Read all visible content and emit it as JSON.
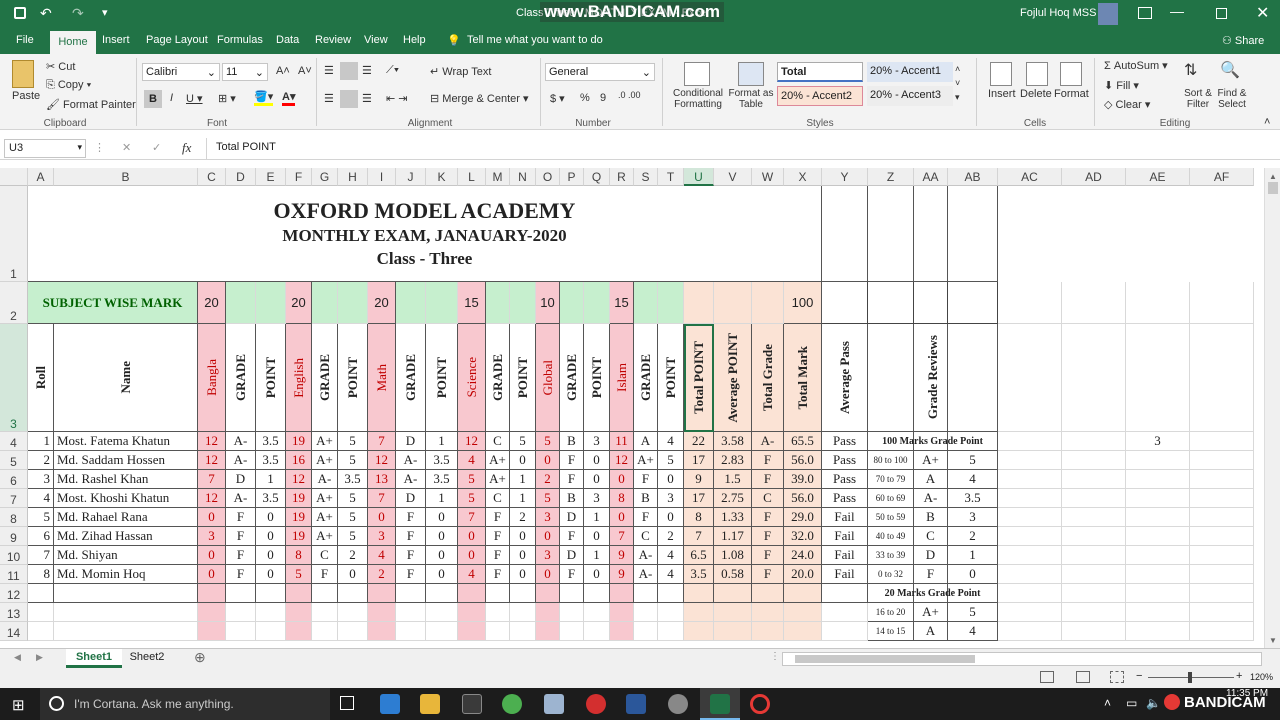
{
  "app": {
    "title": "Class Three - MONTHLY EXAM - Excel",
    "watermark": "www.BANDICAM.com",
    "user": "Fojlul Hoq MSS"
  },
  "menu": [
    "File",
    "Home",
    "Insert",
    "Page Layout",
    "Formulas",
    "Data",
    "Review",
    "View",
    "Help"
  ],
  "tell_me": "Tell me what you want to do",
  "share": "Share",
  "ribbon": {
    "paste": "Paste",
    "cut": "Cut",
    "copy": "Copy",
    "format_painter": "Format Painter",
    "clipboard": "Clipboard",
    "font_name": "Calibri",
    "font_size": "11",
    "font": "Font",
    "wrap_text": "Wrap Text",
    "merge_center": "Merge & Center",
    "alignment": "Alignment",
    "number_format": "General",
    "number": "Number",
    "conditional": "Conditional Formatting",
    "format_as_table": "Format as Table",
    "style_total": "Total",
    "style_a1": "20% - Accent1",
    "style_a2": "20% - Accent2",
    "style_a3": "20% - Accent3",
    "styles": "Styles",
    "insert": "Insert",
    "delete": "Delete",
    "format": "Format",
    "cells": "Cells",
    "autosum": "AutoSum",
    "fill": "Fill",
    "clear": "Clear",
    "sort_filter": "Sort & Filter",
    "find_select": "Find & Select",
    "editing": "Editing"
  },
  "formula_bar": {
    "name_box": "U3",
    "fx": "fx",
    "content": "Total POINT"
  },
  "columns": [
    "A",
    "B",
    "C",
    "D",
    "E",
    "F",
    "G",
    "H",
    "I",
    "J",
    "K",
    "L",
    "M",
    "N",
    "O",
    "P",
    "Q",
    "R",
    "S",
    "T",
    "U",
    "V",
    "W",
    "X",
    "Y",
    "Z",
    "AA",
    "AB",
    "AC",
    "AD",
    "AE",
    "AF"
  ],
  "rows": [
    "1",
    "2",
    "3",
    "4",
    "5",
    "6",
    "7",
    "8",
    "9",
    "10",
    "11",
    "12",
    "13",
    "14"
  ],
  "sheet": {
    "title1": "OXFORD MODEL ACADEMY",
    "title2": "MONTHLY EXAM, JANAUARY-2020",
    "title3": "Class - Three",
    "subject_wise": "SUBJECT WISE MARK",
    "subject_marks": [
      "20",
      "20",
      "20",
      "15",
      "10",
      "15"
    ],
    "total_mark_value": "100",
    "headers": [
      "Roll",
      "Name",
      "Bangla",
      "GRADE",
      "POINT",
      "English",
      "GRADE",
      "POINT",
      "Math",
      "GRADE",
      "POINT",
      "Science",
      "GRADE",
      "POINT",
      "Global",
      "GRADE",
      "POINT",
      "Islam",
      "GRADE",
      "POINT",
      "Total POINT",
      "Average POINT",
      "Total Grade",
      "Total Mark",
      "Average Pass",
      "Grade Reviews"
    ],
    "students": [
      [
        "1",
        "Most. Fatema Khatun",
        "12",
        "A-",
        "3.5",
        "19",
        "A+",
        "5",
        "7",
        "D",
        "1",
        "12",
        "C",
        "5",
        "5",
        "B",
        "3",
        "11",
        "A",
        "4",
        "22",
        "3.58",
        "A-",
        "65.5",
        "Pass"
      ],
      [
        "2",
        "Md. Saddam Hossen",
        "12",
        "A-",
        "3.5",
        "16",
        "A+",
        "5",
        "12",
        "A-",
        "3.5",
        "4",
        "A+",
        "0",
        "0",
        "F",
        "0",
        "12",
        "A+",
        "5",
        "17",
        "2.83",
        "F",
        "56.0",
        "Pass"
      ],
      [
        "3",
        "Md. Rashel Khan",
        "7",
        "D",
        "1",
        "12",
        "A-",
        "3.5",
        "13",
        "A-",
        "3.5",
        "5",
        "A+",
        "1",
        "2",
        "F",
        "0",
        "0",
        "F",
        "0",
        "9",
        "1.5",
        "F",
        "39.0",
        "Pass"
      ],
      [
        "4",
        "Most. Khoshi Khatun",
        "12",
        "A-",
        "3.5",
        "19",
        "A+",
        "5",
        "7",
        "D",
        "1",
        "5",
        "C",
        "1",
        "5",
        "B",
        "3",
        "8",
        "B",
        "3",
        "17",
        "2.75",
        "C",
        "56.0",
        "Pass"
      ],
      [
        "5",
        "Md. Rahael Rana",
        "0",
        "F",
        "0",
        "19",
        "A+",
        "5",
        "0",
        "F",
        "0",
        "7",
        "F",
        "2",
        "3",
        "D",
        "1",
        "0",
        "F",
        "0",
        "8",
        "1.33",
        "F",
        "29.0",
        "Fail"
      ],
      [
        "6",
        "Md. Zihad Hassan",
        "3",
        "F",
        "0",
        "19",
        "A+",
        "5",
        "3",
        "F",
        "0",
        "0",
        "F",
        "0",
        "0",
        "F",
        "0",
        "7",
        "C",
        "2",
        "7",
        "1.17",
        "F",
        "32.0",
        "Fail"
      ],
      [
        "7",
        "Md. Shiyan",
        "0",
        "F",
        "0",
        "8",
        "C",
        "2",
        "4",
        "F",
        "0",
        "0",
        "F",
        "0",
        "3",
        "D",
        "1",
        "9",
        "A-",
        "4",
        "6.5",
        "1.08",
        "F",
        "24.0",
        "Fail"
      ],
      [
        "8",
        "Md. Momin Hoq",
        "0",
        "F",
        "0",
        "5",
        "F",
        "0",
        "2",
        "F",
        "0",
        "4",
        "F",
        "0",
        "0",
        "F",
        "0",
        "9",
        "A-",
        "4",
        "3.5",
        "0.58",
        "F",
        "20.0",
        "Fail"
      ]
    ],
    "ae4": "3",
    "review100_title": "100 Marks Grade Point",
    "review100": [
      [
        "80 to 100",
        "A+",
        "5"
      ],
      [
        "70 to 79",
        "A",
        "4"
      ],
      [
        "60 to 69",
        "A-",
        "3.5"
      ],
      [
        "50 to 59",
        "B",
        "3"
      ],
      [
        "40 to 49",
        "C",
        "2"
      ],
      [
        "33 to 39",
        "D",
        "1"
      ],
      [
        "0 to 32",
        "F",
        "0"
      ]
    ],
    "review20_title": "20 Marks Grade Point",
    "review20": [
      [
        "16 to 20",
        "A+",
        "5"
      ],
      [
        "14 to 15",
        "A",
        "4"
      ]
    ]
  },
  "sheets": [
    "Sheet1",
    "Sheet2"
  ],
  "zoom": "120%",
  "taskbar": {
    "search": "I'm Cortana. Ask me anything.",
    "time": "11:35 PM",
    "rec": "BANDICAM"
  },
  "colors": {
    "excel_green": "#217346",
    "pink": "#f8c8cf",
    "peach": "#fbe3d5",
    "light_green": "#c6efce",
    "grade_red": "#c00000",
    "title_green": "#006100"
  }
}
